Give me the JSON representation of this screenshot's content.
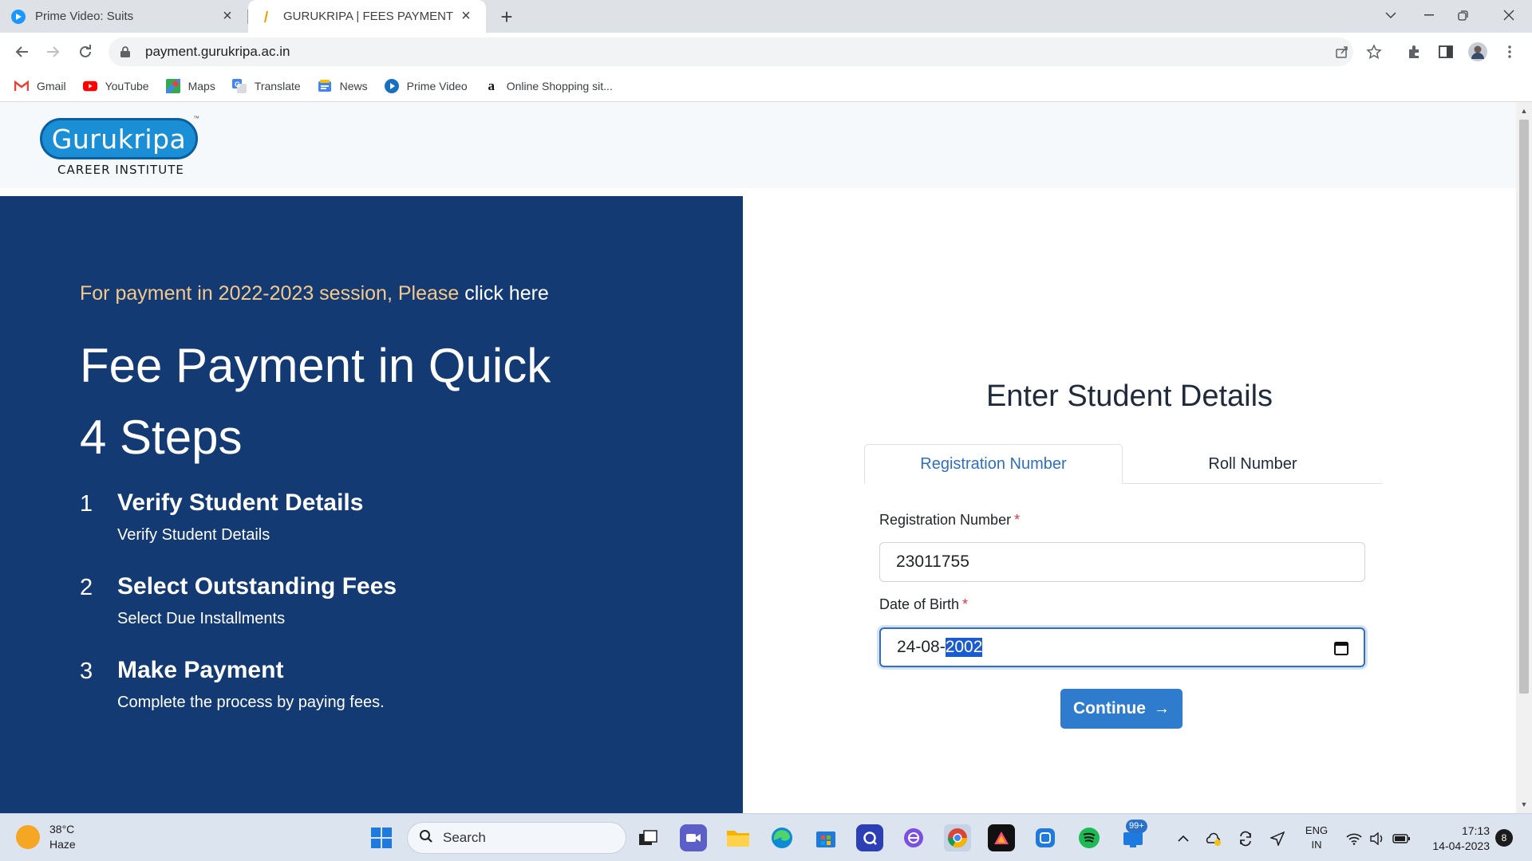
{
  "browser": {
    "tabs": [
      {
        "title": "Prime Video: Suits",
        "active": false,
        "icon": "prime-video-icon"
      },
      {
        "title": "GURUKRIPA | FEES PAYMENT",
        "active": true,
        "icon": "gurukripa-favicon"
      }
    ],
    "url": "payment.gurukripa.ac.in",
    "bookmarks": [
      {
        "label": "Gmail",
        "icon": "gmail-icon"
      },
      {
        "label": "YouTube",
        "icon": "youtube-icon"
      },
      {
        "label": "Maps",
        "icon": "maps-icon"
      },
      {
        "label": "Translate",
        "icon": "translate-icon"
      },
      {
        "label": "News",
        "icon": "news-icon"
      },
      {
        "label": "Prime Video",
        "icon": "prime-video-icon"
      },
      {
        "label": "Online Shopping sit...",
        "icon": "amazon-icon"
      }
    ]
  },
  "site": {
    "logo": {
      "name": "Gurukripa",
      "tagline": "CAREER INSTITUTE",
      "tm": "™"
    },
    "session_notice": {
      "text": "For payment in 2022-2023 session, Please ",
      "link": "click here"
    },
    "hero_title": "Fee Payment in Quick 4 Steps",
    "steps": [
      {
        "number": "1",
        "title": "Verify Student Details",
        "subtitle": "Verify Student Details"
      },
      {
        "number": "2",
        "title": "Select Outstanding Fees",
        "subtitle": "Select Due Installments"
      },
      {
        "number": "3",
        "title": "Make Payment",
        "subtitle": "Complete the process by paying fees."
      }
    ]
  },
  "form": {
    "title": "Enter Student Details",
    "tabs": [
      {
        "label": "Registration Number",
        "active": true
      },
      {
        "label": "Roll Number",
        "active": false
      }
    ],
    "registration": {
      "label": "Registration Number",
      "required": "*",
      "value": "23011755"
    },
    "dob": {
      "label": "Date of Birth",
      "required": "*",
      "value_prefix": "24-08-",
      "value_selected": "2002"
    },
    "continue_label": "Continue",
    "continue_arrow": "→"
  },
  "taskbar": {
    "weather": {
      "temp": "38°C",
      "condition": "Haze"
    },
    "search_placeholder": "Search",
    "badge_count": "99+",
    "language": {
      "line1": "ENG",
      "line2": "IN"
    },
    "time": "17:13",
    "date": "14-04-2023",
    "notifications": "8"
  },
  "colors": {
    "panel_navy": "#133a73",
    "accent_blue": "#2f7ccf",
    "session_text": "#f5c98a",
    "required_red": "#dc3545"
  }
}
